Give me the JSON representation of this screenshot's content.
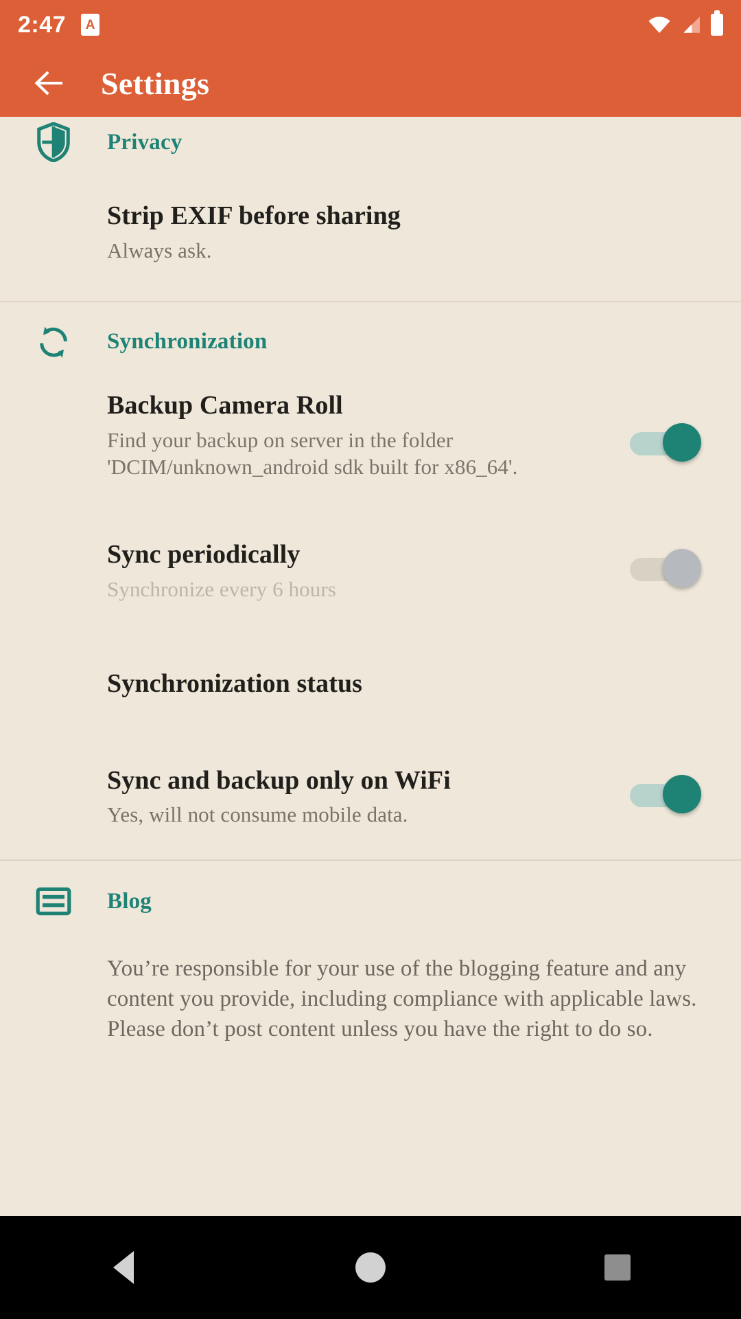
{
  "status_bar": {
    "time": "2:47",
    "app_badge_letter": "A",
    "icons": [
      "wifi-icon",
      "cell-signal-icon",
      "battery-icon"
    ]
  },
  "app_bar": {
    "back_label": "Back",
    "title": "Settings"
  },
  "colors": {
    "header": "#DC5F38",
    "background": "#EFE8DA",
    "accent": "#1E8275",
    "title_text": "#211F1C",
    "subtitle_text": "#7A736A",
    "disabled_text": "#BDB5A8",
    "divider": "#DED5C4"
  },
  "sections": [
    {
      "id": "privacy",
      "icon": "shield-icon",
      "title": "Privacy",
      "rows": [
        {
          "id": "strip-exif",
          "title": "Strip EXIF before sharing",
          "subtitle": "Always ask.",
          "control": "none"
        }
      ]
    },
    {
      "id": "synchronization",
      "icon": "sync-icon",
      "title": "Synchronization",
      "rows": [
        {
          "id": "backup-camera-roll",
          "title": "Backup Camera Roll",
          "subtitle": "Find your backup on server in the folder 'DCIM/unknown_android sdk built for x86_64'.",
          "control": "switch",
          "switch_state": "on"
        },
        {
          "id": "sync-periodically",
          "title": "Sync periodically",
          "subtitle": "Synchronize every 6 hours",
          "control": "switch",
          "switch_state": "off",
          "disabled": true
        },
        {
          "id": "synchronization-status",
          "title": "Synchronization status",
          "subtitle": "",
          "control": "none"
        },
        {
          "id": "sync-only-wifi",
          "title": "Sync and backup only on WiFi",
          "subtitle": "Yes, will not consume mobile data.",
          "control": "switch",
          "switch_state": "on"
        }
      ]
    },
    {
      "id": "blog",
      "icon": "article-icon",
      "title": "Blog",
      "paragraph": "You’re responsible for your use of the blogging feature and any content you provide, including compliance with applicable laws. Please don’t post content unless you have the right to do so."
    }
  ],
  "nav_bar": {
    "back": "back-triangle-icon",
    "home": "home-circle-icon",
    "recents": "recents-square-icon"
  }
}
